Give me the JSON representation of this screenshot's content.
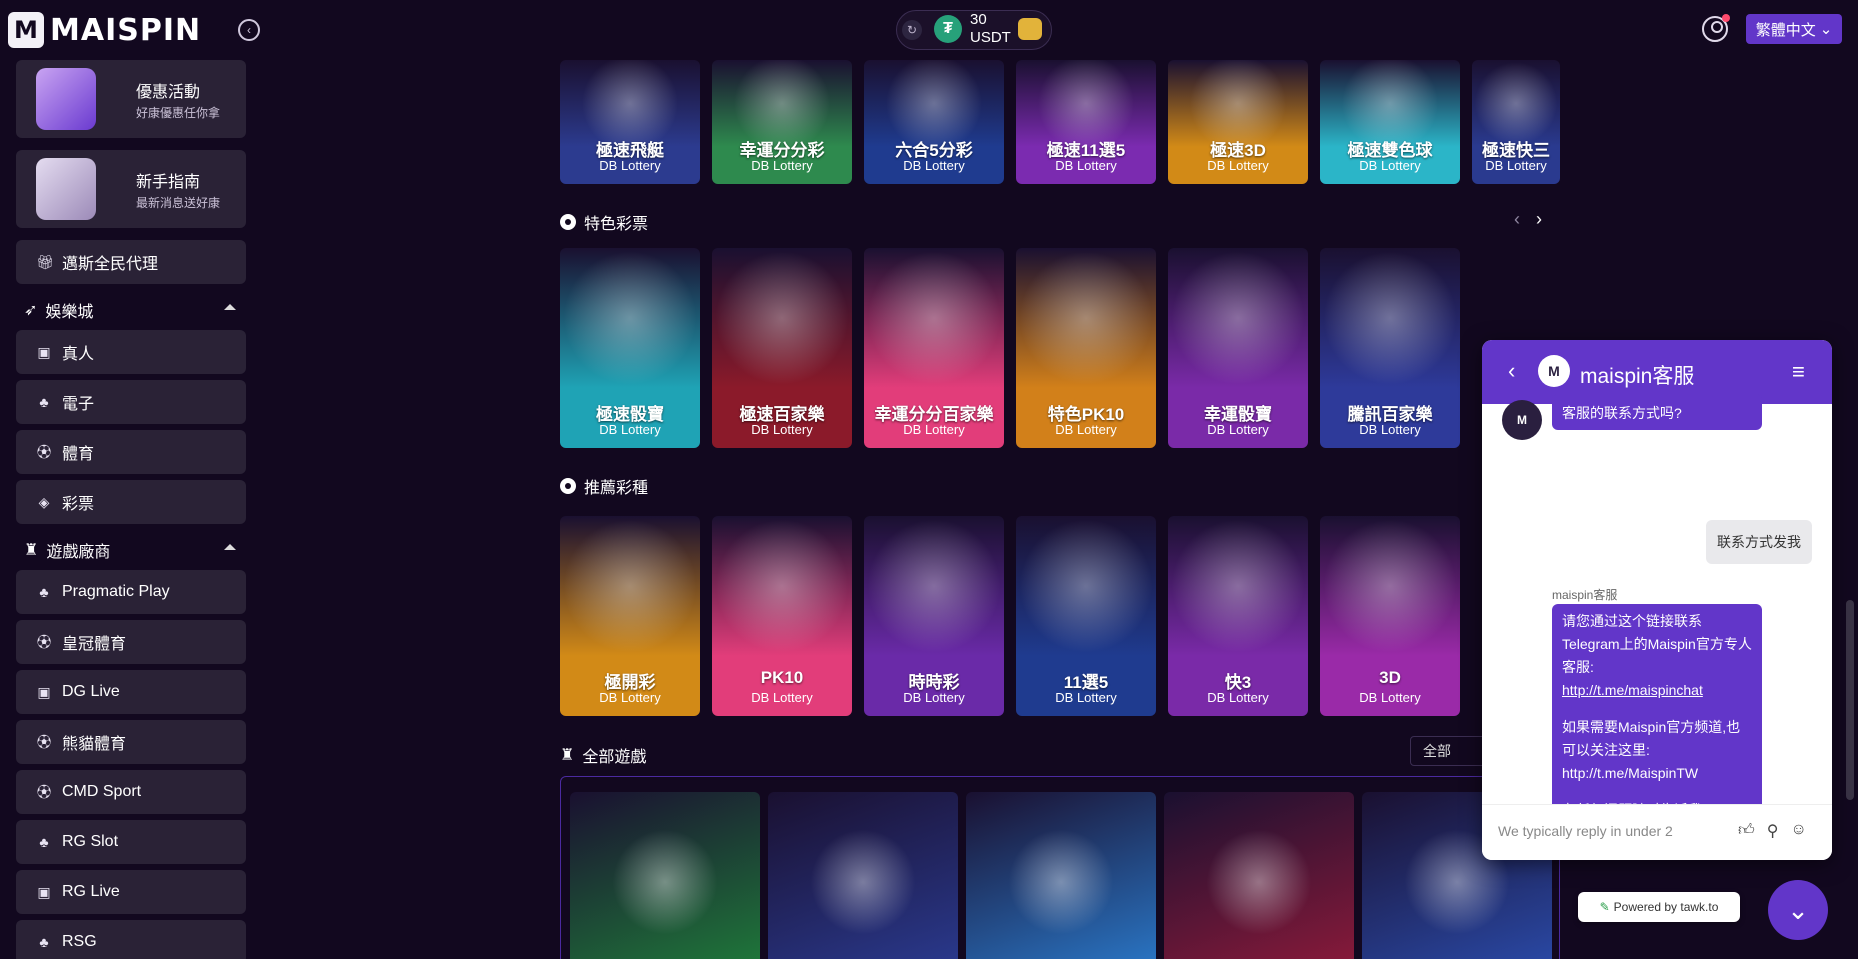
{
  "brand": {
    "logo_mark": "M",
    "name": "MAISPIN"
  },
  "wallet": {
    "amount": "30",
    "currency": "USDT"
  },
  "header": {
    "language": "繁體中文"
  },
  "sidebar": {
    "promos": [
      {
        "title": "優惠活動",
        "sub": "好康優惠任你拿"
      },
      {
        "title": "新手指南",
        "sub": "最新消息送好康"
      }
    ],
    "agent": "邁斯全民代理",
    "casino_heading": "娛樂城",
    "casino_items": [
      "真人",
      "電子",
      "體育",
      "彩票"
    ],
    "provider_heading": "遊戲廠商",
    "provider_items": [
      "Pragmatic Play",
      "皇冠體育",
      "DG Live",
      "熊貓體育",
      "CMD Sport",
      "RG Slot",
      "RG Live",
      "RSG"
    ]
  },
  "main": {
    "top_row": [
      {
        "name": "極速飛艇",
        "prov": "DB Lottery",
        "color": "#2c3b8f"
      },
      {
        "name": "幸運分分彩",
        "prov": "DB Lottery",
        "color": "#2e8a4e"
      },
      {
        "name": "六合5分彩",
        "prov": "DB Lottery",
        "color": "#1f3b8f"
      },
      {
        "name": "極速11選5",
        "prov": "DB Lottery",
        "color": "#7b2bb0"
      },
      {
        "name": "極速3D",
        "prov": "DB Lottery",
        "color": "#d28a17"
      },
      {
        "name": "極速雙色球",
        "prov": "DB Lottery",
        "color": "#2bb5c8"
      },
      {
        "name": "極速快三",
        "prov": "DB Lottery",
        "color": "#2a3a8f"
      }
    ],
    "featured_title": "特色彩票",
    "featured": [
      {
        "name": "極速骰寶",
        "prov": "DB Lottery",
        "color": "#1fa3b5"
      },
      {
        "name": "極速百家樂",
        "prov": "DB Lottery",
        "color": "#8b1a2a"
      },
      {
        "name": "幸運分分百家樂",
        "prov": "DB Lottery",
        "color": "#e23d7a"
      },
      {
        "name": "特色PK10",
        "prov": "DB Lottery",
        "color": "#d2801a"
      },
      {
        "name": "幸運骰寶",
        "prov": "DB Lottery",
        "color": "#7a2aa8"
      },
      {
        "name": "騰訊百家樂",
        "prov": "DB Lottery",
        "color": "#2e3a9a"
      }
    ],
    "recommended_title": "推薦彩種",
    "recommended": [
      {
        "name": "極開彩",
        "prov": "DB Lottery",
        "color": "#d28a17"
      },
      {
        "name": "PK10",
        "prov": "DB Lottery",
        "color": "#e23d7a"
      },
      {
        "name": "時時彩",
        "prov": "DB Lottery",
        "color": "#6a2aa8"
      },
      {
        "name": "11選5",
        "prov": "DB Lottery",
        "color": "#1f3b8f"
      },
      {
        "name": "快3",
        "prov": "DB Lottery",
        "color": "#7a2aa8"
      },
      {
        "name": "3D",
        "prov": "DB Lottery",
        "color": "#9a2aa8"
      }
    ],
    "all_title": "全部遊戲",
    "filter": "全部",
    "all_colors": [
      "#1f7a3a",
      "#2a3a8f",
      "#2a78c8",
      "#8b1a3a",
      "#2a4aa8"
    ]
  },
  "chat": {
    "title": "maispin客服",
    "avatar_label": "M",
    "msg_top": "客服的联系方式吗?",
    "user_msg": "联系方式发我",
    "sender": "maispin客服",
    "bot_lines": [
      "请您通过这个链接联系Telegram上的Maispin官方专人客服:",
      "http://t.me/maispinchat",
      "如果需要Maispin官方频道,也可以关注这里:",
      "http://t.me/MaispinTW",
      "有任何问题随时告诉我!"
    ],
    "input_placeholder": "We typically reply in under 2",
    "powered": "Powered by tawk.to"
  }
}
